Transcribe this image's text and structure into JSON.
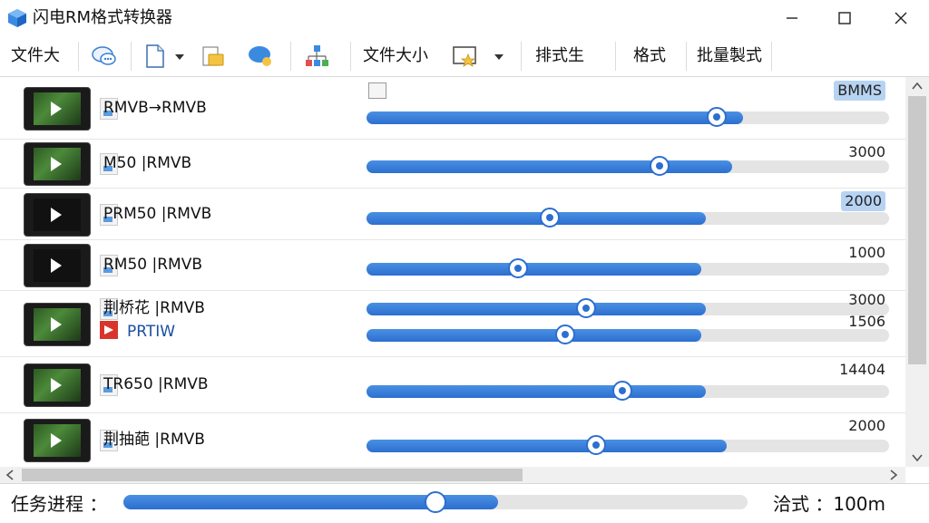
{
  "window": {
    "title": "闪电RM格式转换器",
    "controls": [
      "minimize-icon",
      "maximize-icon",
      "close-icon"
    ]
  },
  "toolbar": {
    "file_size_label": "文件大",
    "file_size2_label": "文件大小",
    "format_gen_label": "排式生",
    "format_label": "格式",
    "batch_label": "批量製式",
    "icons": [
      "chat-icon",
      "document-icon",
      "folder-file-icon",
      "chat-bubble-icon",
      "network-icon",
      "image-star-icon"
    ]
  },
  "rows": [
    {
      "name": "RMVB→RMVB",
      "value": "BMMS",
      "progress": 0.72,
      "knob": 0.67,
      "value_highlight": true,
      "thumb": "green"
    },
    {
      "name": "M50 |RMVB",
      "value": "3000",
      "progress": 0.7,
      "knob": 0.56,
      "value_highlight": false,
      "thumb": "green"
    },
    {
      "name": "PRM50 |RMVB",
      "value": "2000",
      "progress": 0.65,
      "knob": 0.35,
      "value_highlight": true,
      "thumb": "dark"
    },
    {
      "name": "RM50 |RMVB",
      "value": "1000",
      "progress": 0.64,
      "knob": 0.29,
      "value_highlight": false,
      "thumb": "dark"
    },
    {
      "name": "荆桥花 |RMVB",
      "value": "3000",
      "progress": 0.65,
      "knob": 0.42,
      "value_highlight": false,
      "thumb": "green",
      "sub_name": "PRTIW",
      "sub_value": "1506",
      "sub_progress": 0.64,
      "sub_knob": 0.38
    },
    {
      "name": "TR650 |RMVB",
      "value": "14404",
      "progress": 0.65,
      "knob": 0.49,
      "value_highlight": false,
      "thumb": "green"
    },
    {
      "name": "荆抽葩 |RMVB",
      "value": "2000",
      "progress": 0.69,
      "knob": 0.44,
      "value_highlight": false,
      "thumb": "green"
    }
  ],
  "status": {
    "label": "任务进程 ：",
    "progress": 0.6,
    "knob": 0.5,
    "right": "洽式 ：100m"
  }
}
